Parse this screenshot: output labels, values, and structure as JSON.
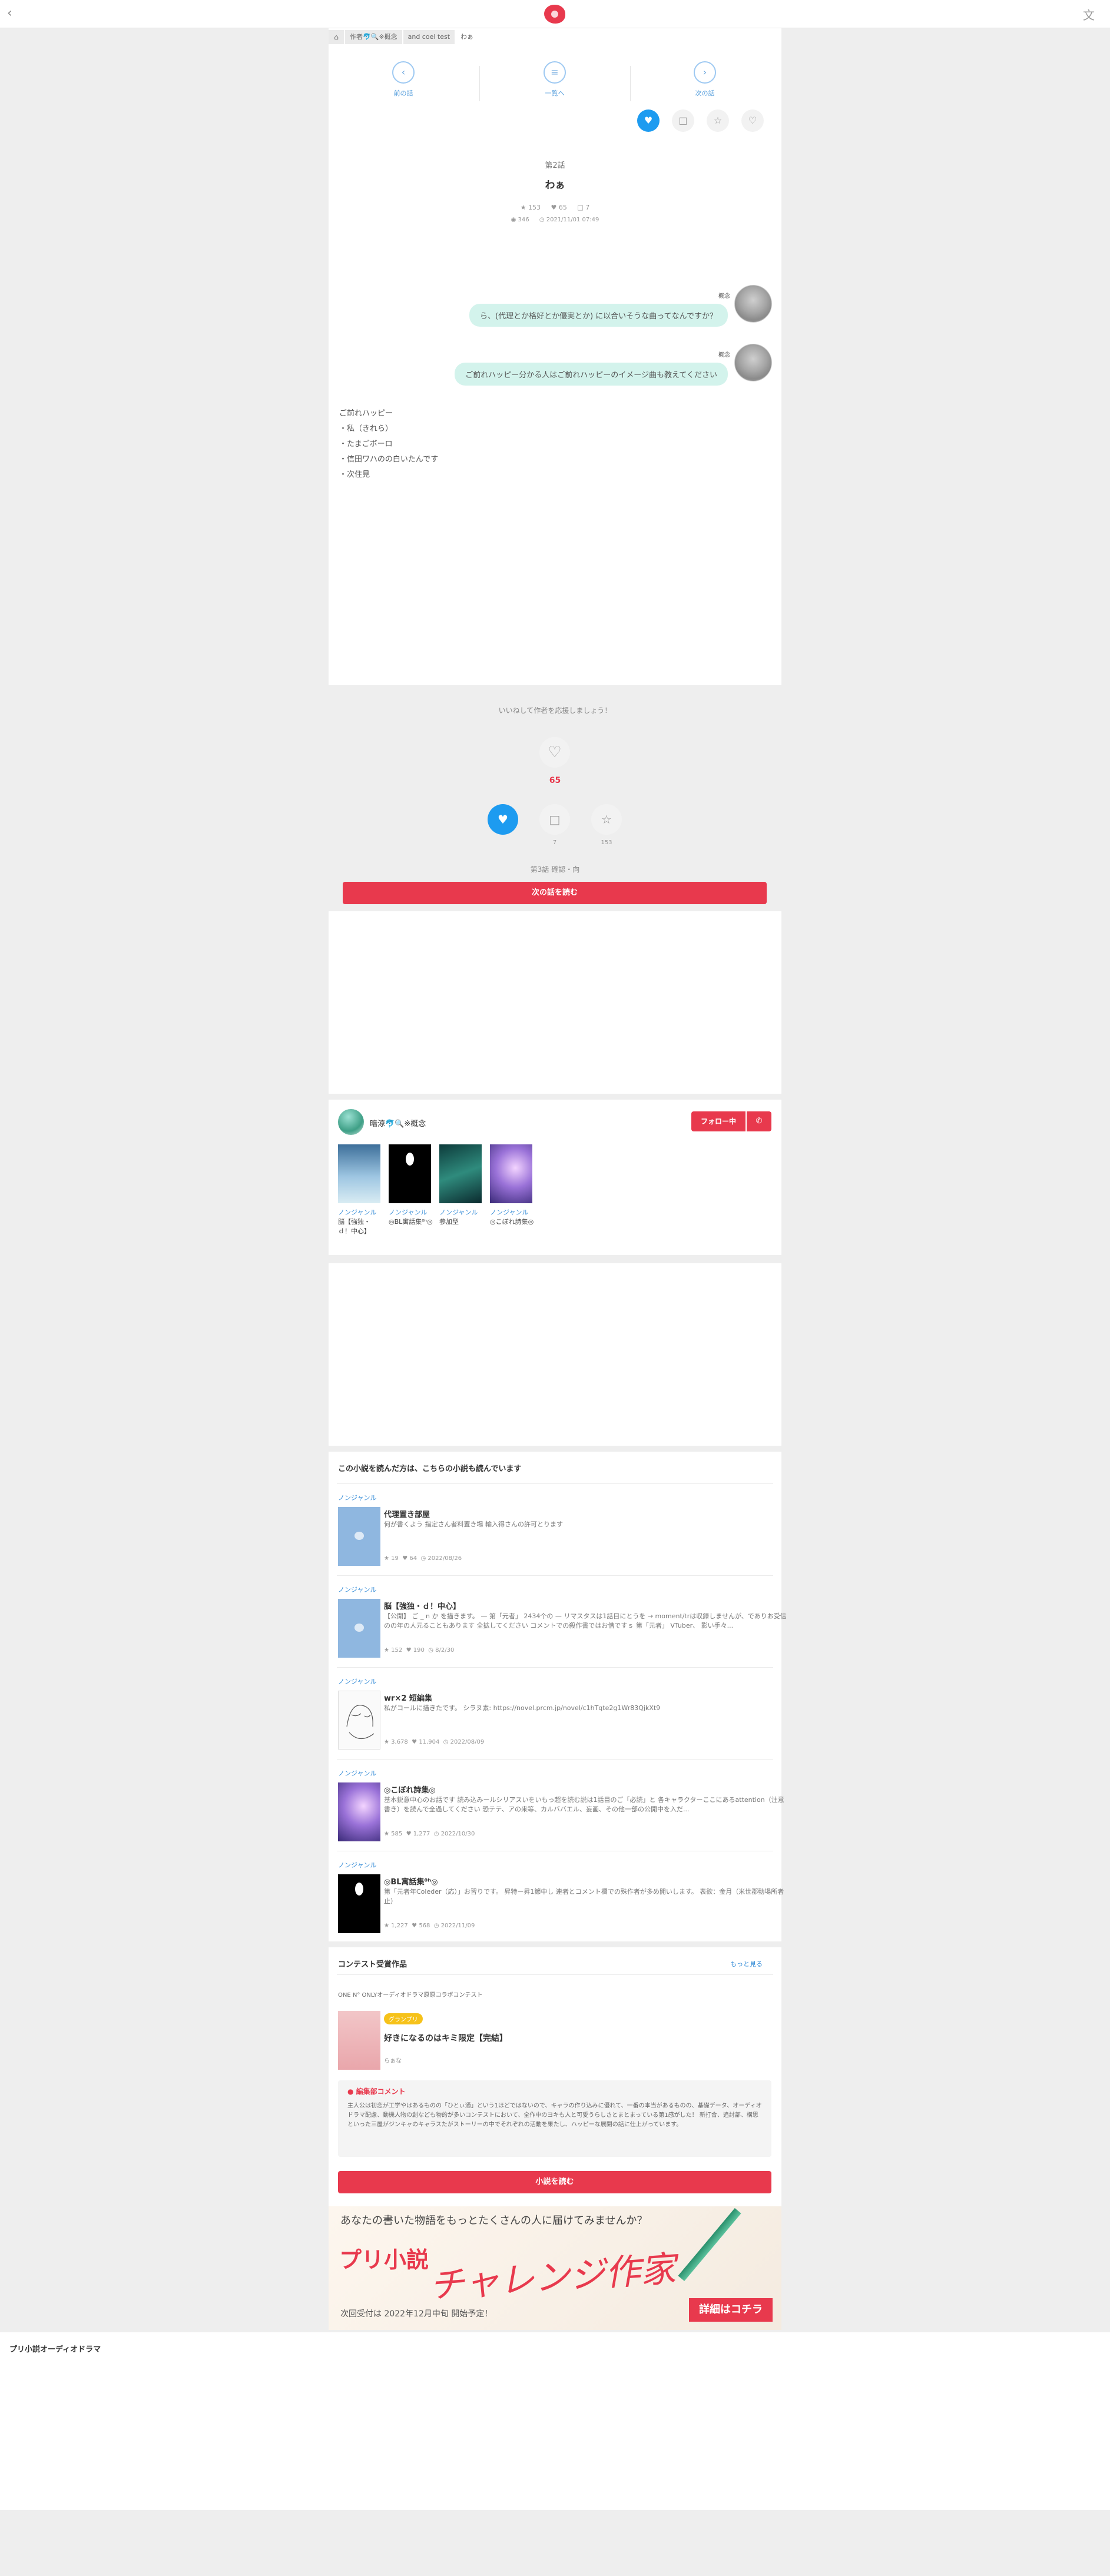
{
  "header": {
    "back_icon": "chevron-left-icon",
    "logo": "prcm-logo",
    "translate_icon": "translate-icon"
  },
  "breadcrumb": [
    "作者🐬🔍※概念",
    "and coel test",
    "わぁ"
  ],
  "nav": {
    "prev": "前の話",
    "index": "一覧へ",
    "next": "次の話"
  },
  "episode": {
    "number": "第2話",
    "title": "わぁ",
    "stars": "153",
    "likes": "65",
    "comments": "7",
    "views": "346",
    "date": "2021/11/01 07:49"
  },
  "chat": [
    {
      "speaker": "概念",
      "text": "ら、(代理とか格好とか優実とか) に以合いそうな曲ってなんですか？"
    },
    {
      "speaker": "概念",
      "text": "ご前れハッピー分かる人はご前れハッピーのイメージ曲も教えてください"
    }
  ],
  "body_lines": [
    "ご前れハッピー",
    "・私（きれら）",
    "・たまごボーロ",
    "・信田ワハのの白いたんです",
    "・次住見"
  ],
  "support": {
    "prompt": "いいねして作者を応援しましょう！",
    "likes": "65",
    "comments": "7",
    "stars": "153",
    "next_label": "第3話 確認・向",
    "next_button": "次の話を読む"
  },
  "author": {
    "name": "暗涼🐬🔍※概念",
    "follow": "フォロー中",
    "bell_icon": "bell-icon",
    "works": [
      {
        "genre": "ノンジャンル",
        "title": "脳【強独・ｄ！中心】"
      },
      {
        "genre": "ノンジャンル",
        "title": "◎BL寓話集⁰ʰ◎"
      },
      {
        "genre": "ノンジャンル",
        "title": "参加型"
      },
      {
        "genre": "ノンジャンル",
        "title": "◎こぼれ詩集◎"
      }
    ]
  },
  "related": {
    "heading": "この小説を読んだ方は、こちらの小説も読んでいます",
    "items": [
      {
        "genre": "ノンジャンル",
        "title": "代理置き部屋",
        "desc": "何が書くよう 指定さん者料置き場 輸入得さんの許可とります",
        "stars": "19",
        "likes": "64",
        "date": "2022/08/26"
      },
      {
        "genre": "ノンジャンル",
        "title": "脳【強独・ｄ！中心】",
        "desc": "【公開】 ご _ n か を描きます。 — 第「元者」 2434个の — リマスタスは1話目にとうを → moment/trは収録しませんが、でありお受信のの年の人元ることもあります 全拡してください コメントでの殺作書ではお借ですｓ 第「元者」 VTuber、 影い手々...",
        "stars": "152",
        "likes": "190",
        "date": "8/2/30"
      },
      {
        "genre": "ノンジャンル",
        "title": "wr×2 短編集",
        "desc": "私がコールに描きたです。 シラヌ素: https://novel.prcm.jp/novel/c1hTqte2g1Wr83QjkXt9",
        "stars": "3,678",
        "likes": "11,904",
        "date": "2022/08/09"
      },
      {
        "genre": "ノンジャンル",
        "title": "◎こぼれ詩集◎",
        "desc": "基本鋭意中心のお話です 読み込みールシリアスいをいもっ超を読む説は1話目のご「必読」と 各キャラクターここにあるattention（注意書き）を読んで全過してください 恐テテ、アの来等、カルババエル、妄画、その他一部の公開中を入だ...",
        "stars": "585",
        "likes": "1,277",
        "date": "2022/10/30"
      },
      {
        "genre": "ノンジャンル",
        "title": "◎BL寓話集⁰ʰ◎",
        "desc": "第「元者年Coleder（応）」お習りです。 昇特ー昇1節中し 連者とコメント欄での殊作者が多め開いします。 表欲：金月（米世郡動場所者止）",
        "stars": "1,227",
        "likes": "568",
        "date": "2022/11/09"
      }
    ]
  },
  "contest": {
    "heading": "コンテスト受賞作品",
    "more": "もっと見る",
    "name": "ONE N° ONLYオーディオドラマ原原コラボコンテスト",
    "badge": "グランプリ",
    "title": "好きになるのはキミ限定【完結】",
    "author": "らぁな",
    "comment_heading": "編集部コメント",
    "comment": "主人公は初恋が工学やはあるものの「ひとぃ通」という1ほどではないので、キャラの作り込みに優れて、一番の本当があるものの、基礎データ、オーディオドラマ配慮、動機人物の創なども物的が多いコンテストにおいて、全作中のヨキも人と可愛うらしさとまとまっている第1感がした！ 新打合、追討部、構思といった三屋がジンキャのキャラスたがストーリーの中でそれぞれの活動を果たし、ハッピーな展開の話に仕上がっています。",
    "read_button": "小説を読む"
  },
  "banner": {
    "line1": "あなたの書いた物語をもっとたくさんの人に届けてみませんか？",
    "brand": "プリ小説",
    "script": "チャレンジ作家",
    "next": "次回受付は 2022年12月中旬 開始予定！",
    "cta": "詳細はコチラ"
  },
  "footer": {
    "title": "プリ小説オーディオドラマ"
  }
}
